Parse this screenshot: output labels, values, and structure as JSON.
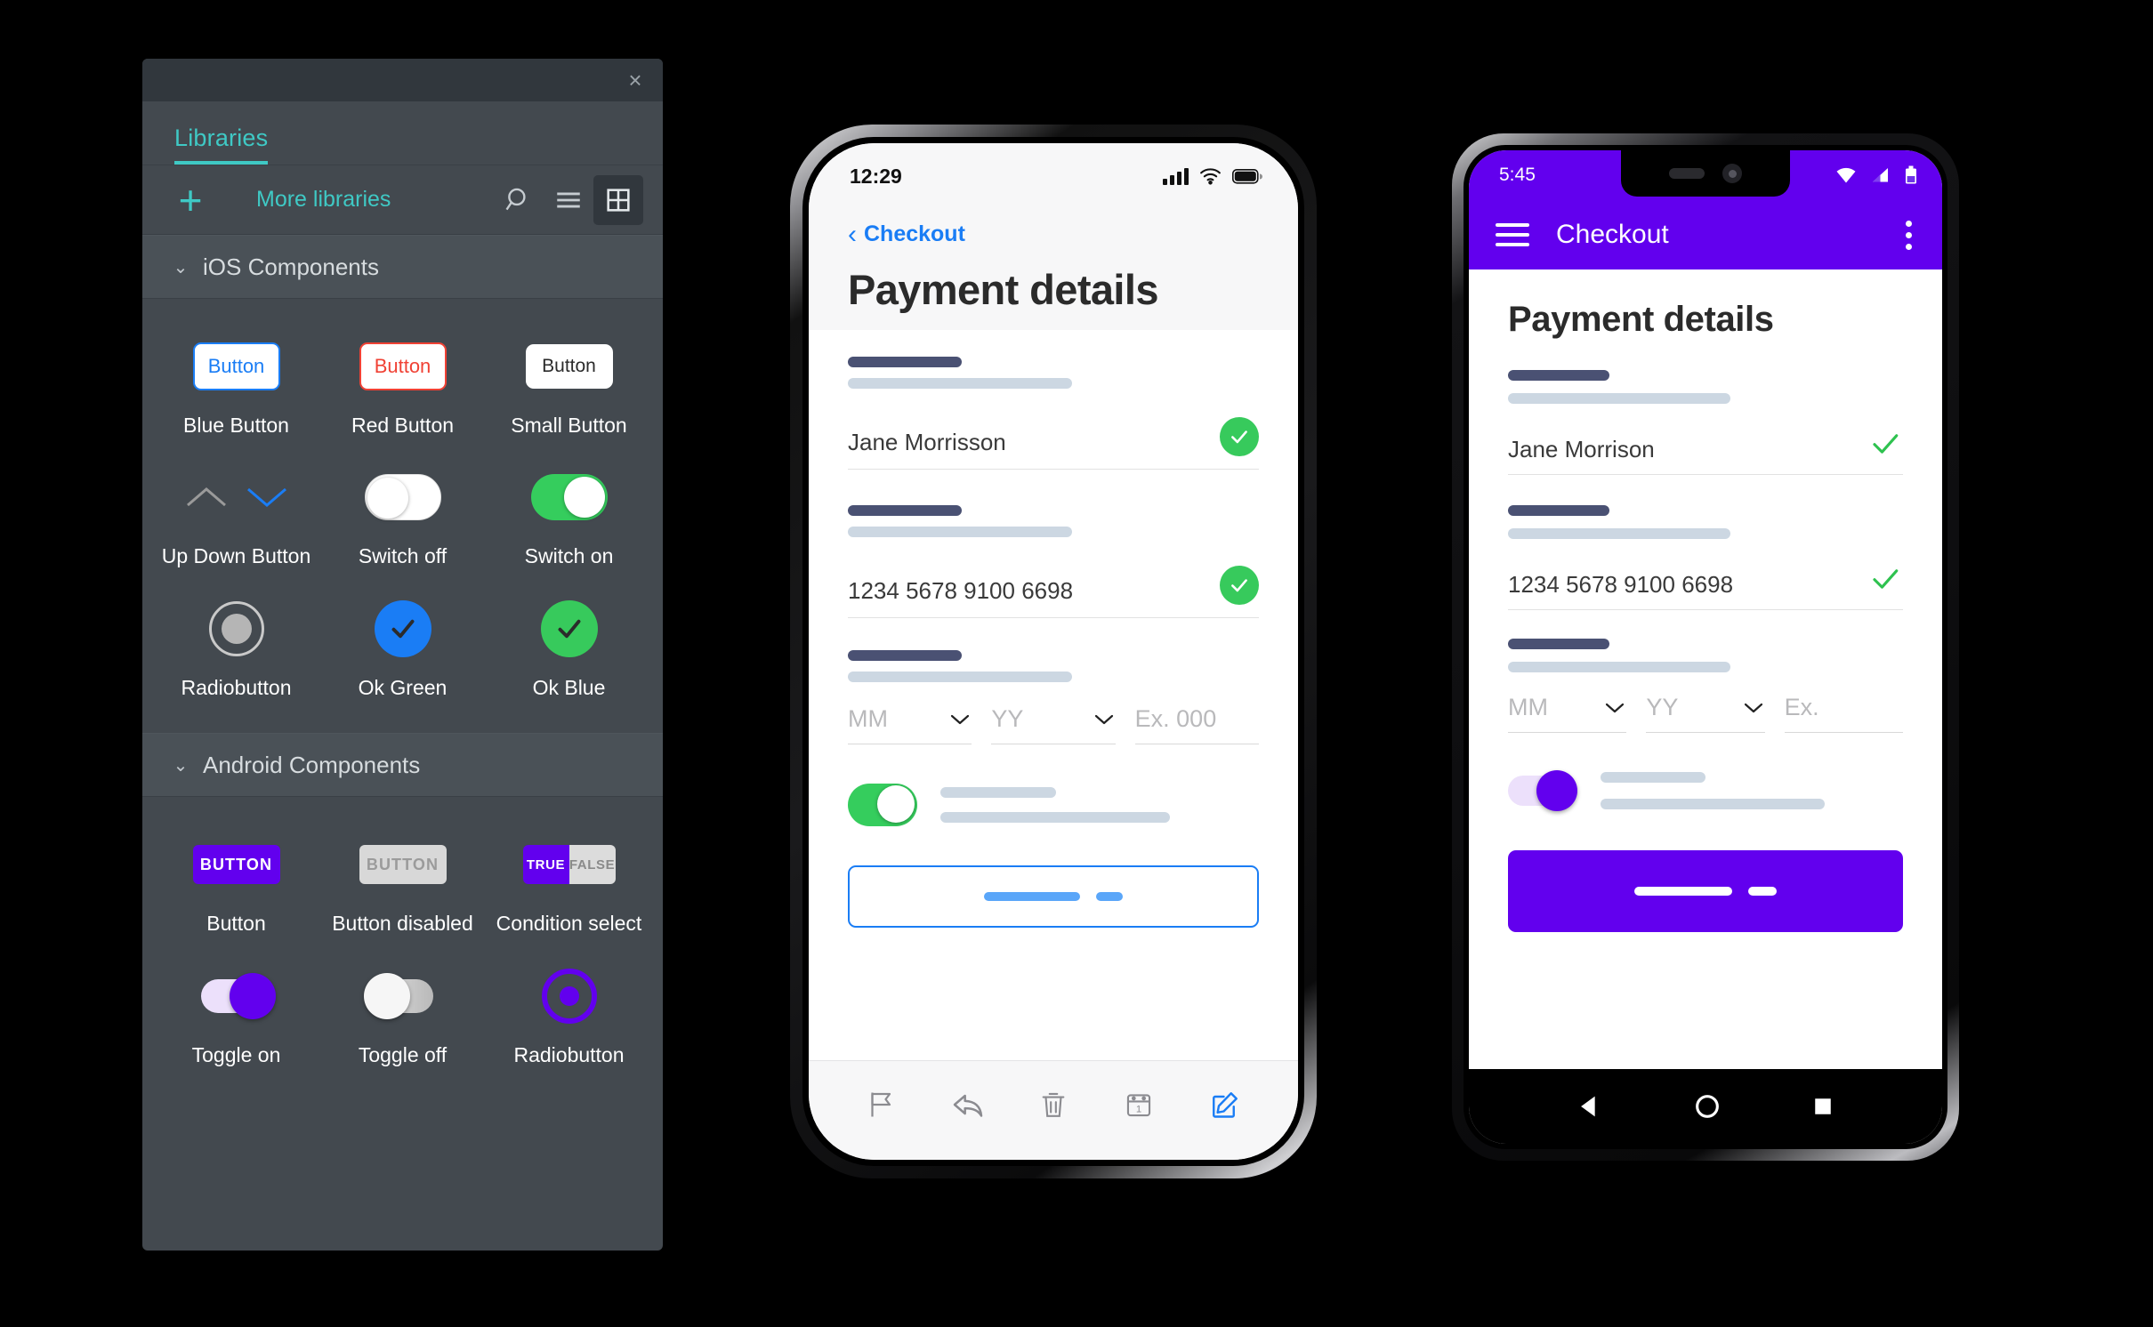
{
  "panel": {
    "close_icon": "×",
    "tab_label": "Libraries",
    "toolbar": {
      "add_label": "+",
      "more_libraries_label": "More libraries",
      "search_icon": "search-icon",
      "list_icon": "list-view-icon",
      "grid_icon": "grid-view-icon"
    },
    "sections": [
      {
        "title": "iOS Components",
        "chevron": "⌄",
        "items": [
          {
            "label": "Blue Button",
            "art": "ios-blue-button",
            "text": "Button"
          },
          {
            "label": "Red Button",
            "art": "ios-red-button",
            "text": "Button"
          },
          {
            "label": "Small Button",
            "art": "ios-small-button",
            "text": "Button"
          },
          {
            "label": "Up Down Button",
            "art": "ios-updown",
            "text": ""
          },
          {
            "label": "Switch off",
            "art": "ios-switch-off",
            "text": ""
          },
          {
            "label": "Switch on",
            "art": "ios-switch-on",
            "text": ""
          },
          {
            "label": "Radiobutton",
            "art": "ios-radio",
            "text": ""
          },
          {
            "label": "Ok Green",
            "art": "ios-ok-blue-circle",
            "text": ""
          },
          {
            "label": "Ok Blue",
            "art": "ios-ok-green-circle",
            "text": ""
          }
        ]
      },
      {
        "title": "Android Components",
        "chevron": "⌄",
        "items": [
          {
            "label": "Button",
            "art": "and-button",
            "text": "BUTTON"
          },
          {
            "label": "Button disabled",
            "art": "and-button-disabled",
            "text": "BUTTON"
          },
          {
            "label": "Condition select",
            "art": "and-condition",
            "text_true": "TRUE",
            "text_false": "FALSE"
          },
          {
            "label": "Toggle on",
            "art": "and-toggle-on",
            "text": ""
          },
          {
            "label": "Toggle off",
            "art": "and-toggle-off",
            "text": ""
          },
          {
            "label": "Radiobutton",
            "art": "and-radio",
            "text": ""
          }
        ]
      }
    ]
  },
  "iphone": {
    "status": {
      "time": "12:29",
      "signal_icon": "cellular-signal-icon",
      "wifi_icon": "wifi-icon",
      "battery_icon": "battery-icon"
    },
    "back_label": "Checkout",
    "back_chevron": "‹",
    "page_title": "Payment details",
    "fields": [
      {
        "name_value": "Jane Morrisson",
        "status": "valid"
      },
      {
        "name_value": "1234 5678 9100 6698",
        "status": "valid"
      }
    ],
    "expiry": {
      "month_placeholder": "MM",
      "year_placeholder": "YY",
      "cvv_placeholder": "Ex. 000",
      "chevron": "⌄"
    },
    "toggle_state": "on",
    "cta_label": "",
    "toolbar_icons": [
      "flag-icon",
      "reply-icon",
      "trash-icon",
      "calendar-icon",
      "compose-icon"
    ]
  },
  "android": {
    "status": {
      "time": "5:45",
      "wifi_icon": "wifi-icon",
      "signal_icon": "cellular-signal-icon",
      "battery_icon": "battery-icon"
    },
    "appbar": {
      "menu_icon": "hamburger-menu-icon",
      "title": "Checkout",
      "overflow_icon": "overflow-menu-icon"
    },
    "page_title": "Payment details",
    "fields": [
      {
        "name_value": "Jane Morrison",
        "status": "valid"
      },
      {
        "name_value": "1234 5678 9100 6698",
        "status": "valid"
      }
    ],
    "expiry": {
      "month_placeholder": "MM",
      "year_placeholder": "YY",
      "cvv_placeholder": "Ex.",
      "chevron": "⌄"
    },
    "toggle_state": "on",
    "cta_label": "",
    "nav_icons": [
      "back-triangle-icon",
      "home-circle-icon",
      "recents-square-icon"
    ]
  },
  "colors": {
    "panel_bg": "#43494f",
    "panel_titlebar": "#31373d",
    "accent_teal": "#3fc9c5",
    "ios_blue": "#1a7df5",
    "ios_red": "#f04134",
    "ios_green": "#35cd5d",
    "android_purple": "#6200ee",
    "skeleton_dark": "#4a5173",
    "skeleton_light": "#ccd7e2"
  }
}
